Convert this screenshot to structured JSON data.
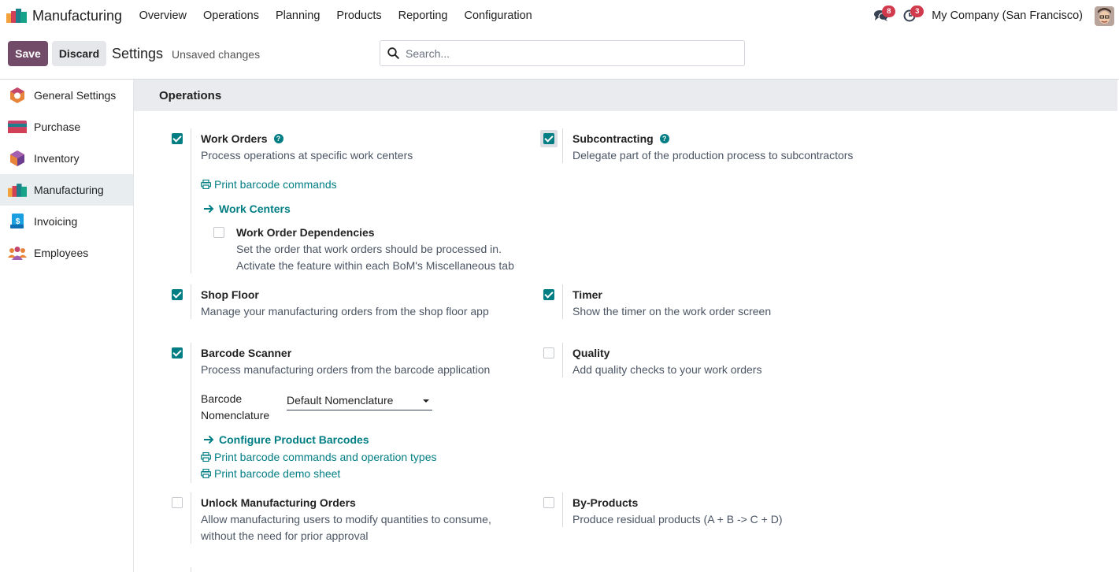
{
  "navbar": {
    "app_name": "Manufacturing",
    "menu": [
      "Overview",
      "Operations",
      "Planning",
      "Products",
      "Reporting",
      "Configuration"
    ],
    "messages_badge": "8",
    "activities_badge": "3",
    "company": "My Company (San Francisco)"
  },
  "controls": {
    "save_label": "Save",
    "discard_label": "Discard",
    "title": "Settings",
    "status": "Unsaved changes",
    "search_placeholder": "Search..."
  },
  "sidebar": {
    "items": [
      {
        "label": "General Settings",
        "icon": "general-settings-icon"
      },
      {
        "label": "Purchase",
        "icon": "purchase-icon"
      },
      {
        "label": "Inventory",
        "icon": "inventory-icon"
      },
      {
        "label": "Manufacturing",
        "icon": "manufacturing-icon",
        "active": true
      },
      {
        "label": "Invoicing",
        "icon": "invoicing-icon"
      },
      {
        "label": "Employees",
        "icon": "employees-icon"
      }
    ]
  },
  "section": {
    "title": "Operations"
  },
  "settings": {
    "work_orders": {
      "title": "Work Orders",
      "desc": "Process operations at specific work centers",
      "checked": true,
      "link_print": "Print barcode commands",
      "link_work_centers": "Work Centers",
      "dependencies": {
        "title": "Work Order Dependencies",
        "desc1": "Set the order that work orders should be processed in.",
        "desc2": "Activate the feature within each BoM's Miscellaneous tab",
        "checked": false
      }
    },
    "subcontracting": {
      "title": "Subcontracting",
      "desc": "Delegate part of the production process to subcontractors",
      "checked": true
    },
    "shop_floor": {
      "title": "Shop Floor",
      "desc": "Manage your manufacturing orders from the shop floor app",
      "checked": true
    },
    "timer": {
      "title": "Timer",
      "desc": "Show the timer on the work order screen",
      "checked": true
    },
    "barcode_scanner": {
      "title": "Barcode Scanner",
      "desc": "Process manufacturing orders from the barcode application",
      "checked": true,
      "nomenclature_label_1": "Barcode",
      "nomenclature_label_2": "Nomenclature",
      "nomenclature_value": "Default Nomenclature",
      "link_configure": "Configure Product Barcodes",
      "link_print_ops": "Print barcode commands and operation types",
      "link_print_demo": "Print barcode demo sheet"
    },
    "quality": {
      "title": "Quality",
      "desc": "Add quality checks to your work orders",
      "checked": false
    },
    "unlock_mo": {
      "title": "Unlock Manufacturing Orders",
      "desc1": "Allow manufacturing users to modify quantities to consume,",
      "desc2": "without the need for prior approval",
      "checked": false
    },
    "by_products": {
      "title": "By-Products",
      "desc": "Produce residual products (A + B -> C + D)",
      "checked": false
    }
  },
  "colors": {
    "brand": "#714b67",
    "accent": "#017e84",
    "badge": "#d13a4d"
  }
}
